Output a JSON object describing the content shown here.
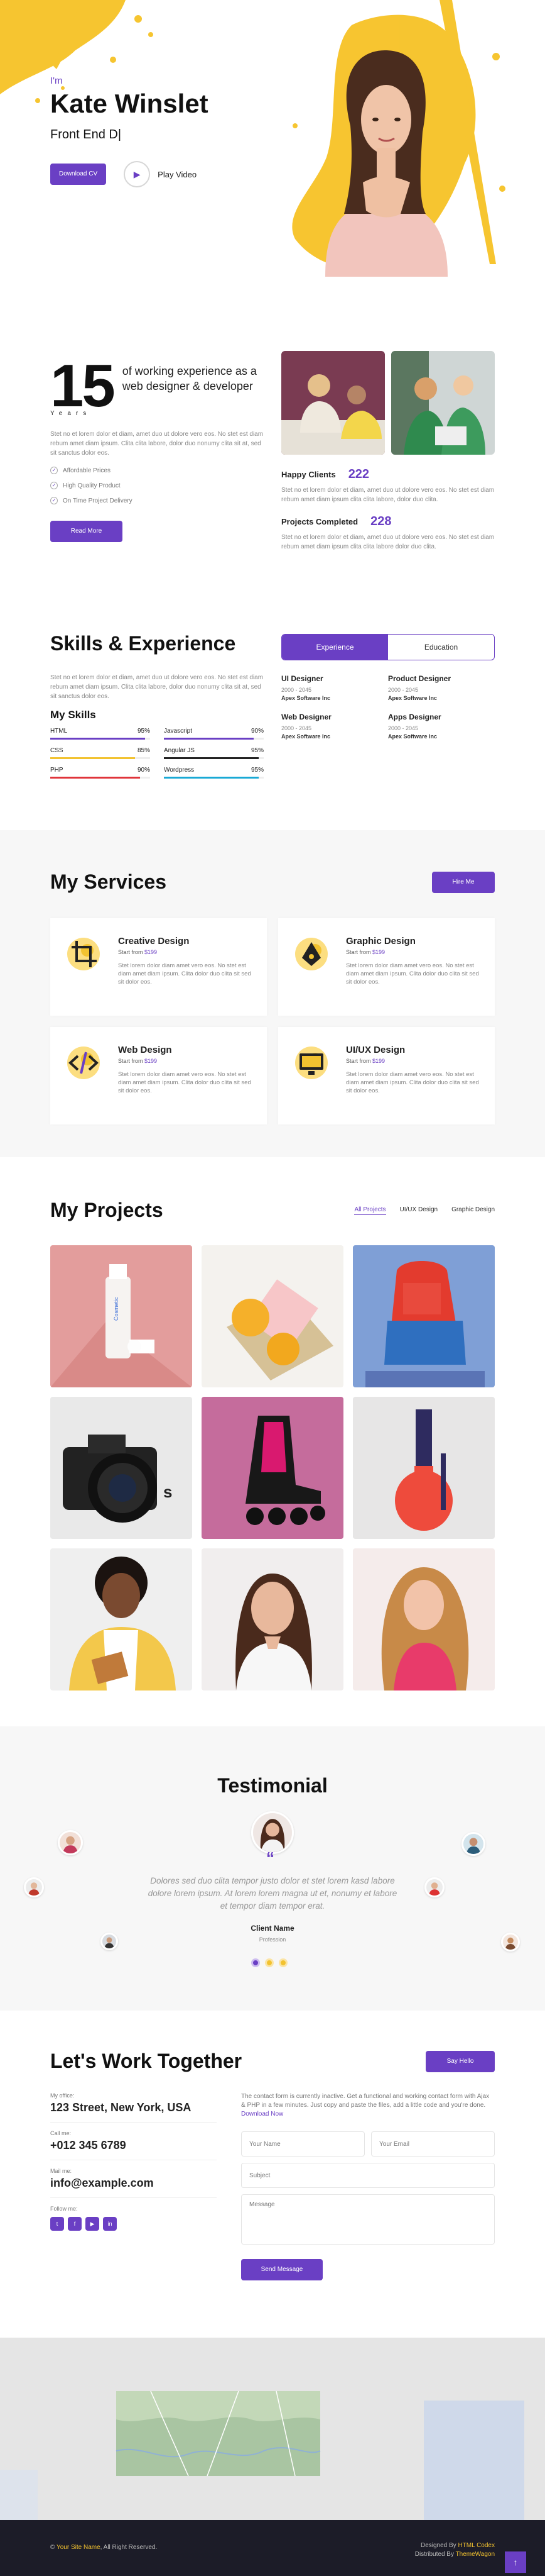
{
  "colors": {
    "accent": "#6a3fc4",
    "yellow": "#f2c230"
  },
  "hero": {
    "greeting": "I'm",
    "name": "Kate Winslet",
    "role": "Front End D|",
    "cta": "Download CV",
    "play_label": "Play Video",
    "play_icon": "play-icon"
  },
  "about": {
    "years_num": "15",
    "years_text": "of working experience as a web designer & developer",
    "years_label": "Years",
    "desc": "Stet no et lorem dolor et diam, amet duo ut dolore vero eos. No stet est diam rebum amet diam ipsum. Clita clita labore, dolor duo nonumy clita sit at, sed sit sanctus dolor eos.",
    "checks": [
      "Affordable Prices",
      "High Quality Product",
      "On Time Project Delivery"
    ],
    "button": "Read More",
    "happy_label": "Happy Clients",
    "happy_num": "222",
    "happy_desc": "Stet no et lorem dolor et diam, amet duo ut dolore vero eos. No stet est diam rebum amet diam ipsum clita clita labore, dolor duo clita.",
    "projects_label": "Projects Completed",
    "projects_num": "228",
    "projects_desc": "Stet no et lorem dolor et diam, amet duo ut dolore vero eos. No stet est diam rebum amet diam ipsum clita clita labore dolor duo clita."
  },
  "skills": {
    "title": "Skills & Experience",
    "desc": "Stet no et lorem dolor et diam, amet duo ut dolore vero eos. No stet est diam rebum amet diam ipsum. Clita clita labore, dolor duo nonumy clita sit at, sed sit sanctus dolor eos.",
    "my_skills": "My Skills",
    "list": [
      {
        "name": "HTML",
        "pct": "95%",
        "value": 95,
        "color": "#6a3fc4"
      },
      {
        "name": "Javascript",
        "pct": "90%",
        "value": 90,
        "color": "#6a3fc4"
      },
      {
        "name": "CSS",
        "pct": "85%",
        "value": 85,
        "color": "#f2c230"
      },
      {
        "name": "Angular JS",
        "pct": "95%",
        "value": 95,
        "color": "#222222"
      },
      {
        "name": "PHP",
        "pct": "90%",
        "value": 90,
        "color": "#e0343a"
      },
      {
        "name": "Wordpress",
        "pct": "95%",
        "value": 95,
        "color": "#19a9d5"
      }
    ],
    "tabs": [
      "Experience",
      "Education"
    ],
    "experience": [
      {
        "title": "UI Designer",
        "years": "2000 - 2045",
        "company": "Apex Software Inc"
      },
      {
        "title": "Product Designer",
        "years": "2000 - 2045",
        "company": "Apex Software Inc"
      },
      {
        "title": "Web Designer",
        "years": "2000 - 2045",
        "company": "Apex Software Inc"
      },
      {
        "title": "Apps Designer",
        "years": "2000 - 2045",
        "company": "Apex Software Inc"
      }
    ]
  },
  "services": {
    "title": "My Services",
    "button": "Hire Me",
    "start_from": "Start from",
    "items": [
      {
        "title": "Creative Design",
        "price": "$199",
        "icon": "crop-icon",
        "desc": "Stet lorem dolor diam amet vero eos. No stet est diam amet diam ipsum. Clita dolor duo clita sit sed sit dolor eos."
      },
      {
        "title": "Graphic Design",
        "price": "$199",
        "icon": "pen-tool-icon",
        "desc": "Stet lorem dolor diam amet vero eos. No stet est diam amet diam ipsum. Clita dolor duo clita sit sed sit dolor eos."
      },
      {
        "title": "Web Design",
        "price": "$199",
        "icon": "code-icon",
        "desc": "Stet lorem dolor diam amet vero eos. No stet est diam amet diam ipsum. Clita dolor duo clita sit sed sit dolor eos."
      },
      {
        "title": "UI/UX Design",
        "price": "$199",
        "icon": "monitor-icon",
        "desc": "Stet lorem dolor diam amet vero eos. No stet est diam amet diam ipsum. Clita dolor duo clita sit sed sit dolor eos."
      }
    ]
  },
  "projects": {
    "title": "My Projects",
    "filters": [
      "All Projects",
      "UI/UX Design",
      "Graphic Design"
    ],
    "overlap_text": "s",
    "items": [
      "cosmetic-tube-image",
      "oranges-soap-image",
      "backpack-image",
      "camera-image",
      "roller-skate-image",
      "nail-polish-image",
      "woman-tablet-image",
      "woman-smiling-image",
      "woman-curly-image"
    ]
  },
  "testimonial": {
    "title": "Testimonial",
    "text": "Dolores sed duo clita tempor justo dolor et stet lorem kasd labore dolore lorem ipsum. At lorem lorem magna ut et, nonumy et labore et tempor diam tempor erat.",
    "name": "Client Name",
    "role": "Profession"
  },
  "contact": {
    "title": "Let's Work Together",
    "button": "Say Hello",
    "office_label": "My office:",
    "office": "123 Street, New York, USA",
    "call_label": "Call me:",
    "call": "+012 345 6789",
    "mail_label": "Mail me:",
    "mail": "info@example.com",
    "follow_label": "Follow me:",
    "socials": [
      "t",
      "f",
      "▶",
      "in"
    ],
    "note": "The contact form is currently inactive. Get a functional and working contact form with Ajax & PHP in a few minutes. Just copy and paste the files, add a little code and you're done.",
    "note_link": "Download Now",
    "name_ph": "Your Name",
    "email_ph": "Your Email",
    "subject_ph": "Subject",
    "message_ph": "Message",
    "send": "Send Message"
  },
  "footer": {
    "copy_sym": "©",
    "site": "Your Site Name",
    "rights": ", All Right Reserved.",
    "designed_by": "Designed By ",
    "designer": "HTML Codex",
    "distributed_by": "Distributed By ",
    "distributor": "ThemeWagon",
    "top_icon": "↑"
  }
}
